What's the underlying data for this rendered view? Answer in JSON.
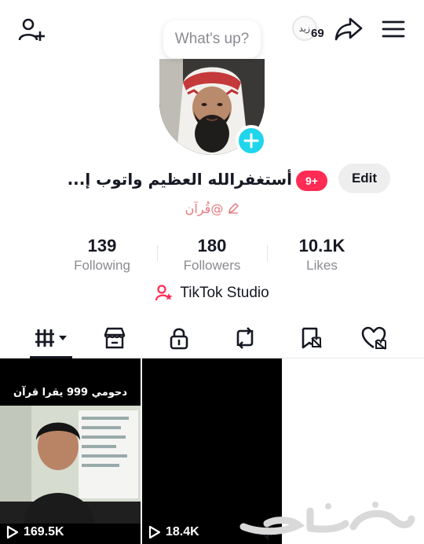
{
  "header": {
    "add_friend_icon": "person-plus-icon",
    "coin_label": "زيد",
    "coin_count": "69",
    "share_icon": "share-arrow-icon",
    "menu_icon": "hamburger-menu-icon",
    "status_bubble": "What's up?"
  },
  "profile": {
    "display_name": "أستغفرالله العظيم واتوب إ...",
    "notification_badge": "9+",
    "edit_label": "Edit",
    "username": "@قُرآن",
    "add_avatar_icon": "plus-icon"
  },
  "stats": [
    {
      "value": "139",
      "label": "Following"
    },
    {
      "value": "180",
      "label": "Followers"
    },
    {
      "value": "10.1K",
      "label": "Likes"
    }
  ],
  "studio": {
    "label": "TikTok Studio",
    "icon": "studio-person-icon"
  },
  "tabs": [
    {
      "name": "videos",
      "icon": "videos-grid-icon",
      "active": true
    },
    {
      "name": "shop",
      "icon": "shop-icon",
      "active": false
    },
    {
      "name": "private",
      "icon": "lock-icon",
      "active": false
    },
    {
      "name": "reposts",
      "icon": "repost-icon",
      "active": false
    },
    {
      "name": "favorites",
      "icon": "bookmark-icon",
      "active": false
    },
    {
      "name": "liked",
      "icon": "heart-icon",
      "active": false
    }
  ],
  "videos": [
    {
      "title": "دحومي 999 يقرا قرآن",
      "views": "169.5K"
    },
    {
      "title": "",
      "views": "18.4K"
    }
  ],
  "colors": {
    "accent_red": "#fe2c55",
    "accent_cyan": "#20d5ec",
    "text_primary": "#161823",
    "text_secondary": "#8a8b91"
  }
}
